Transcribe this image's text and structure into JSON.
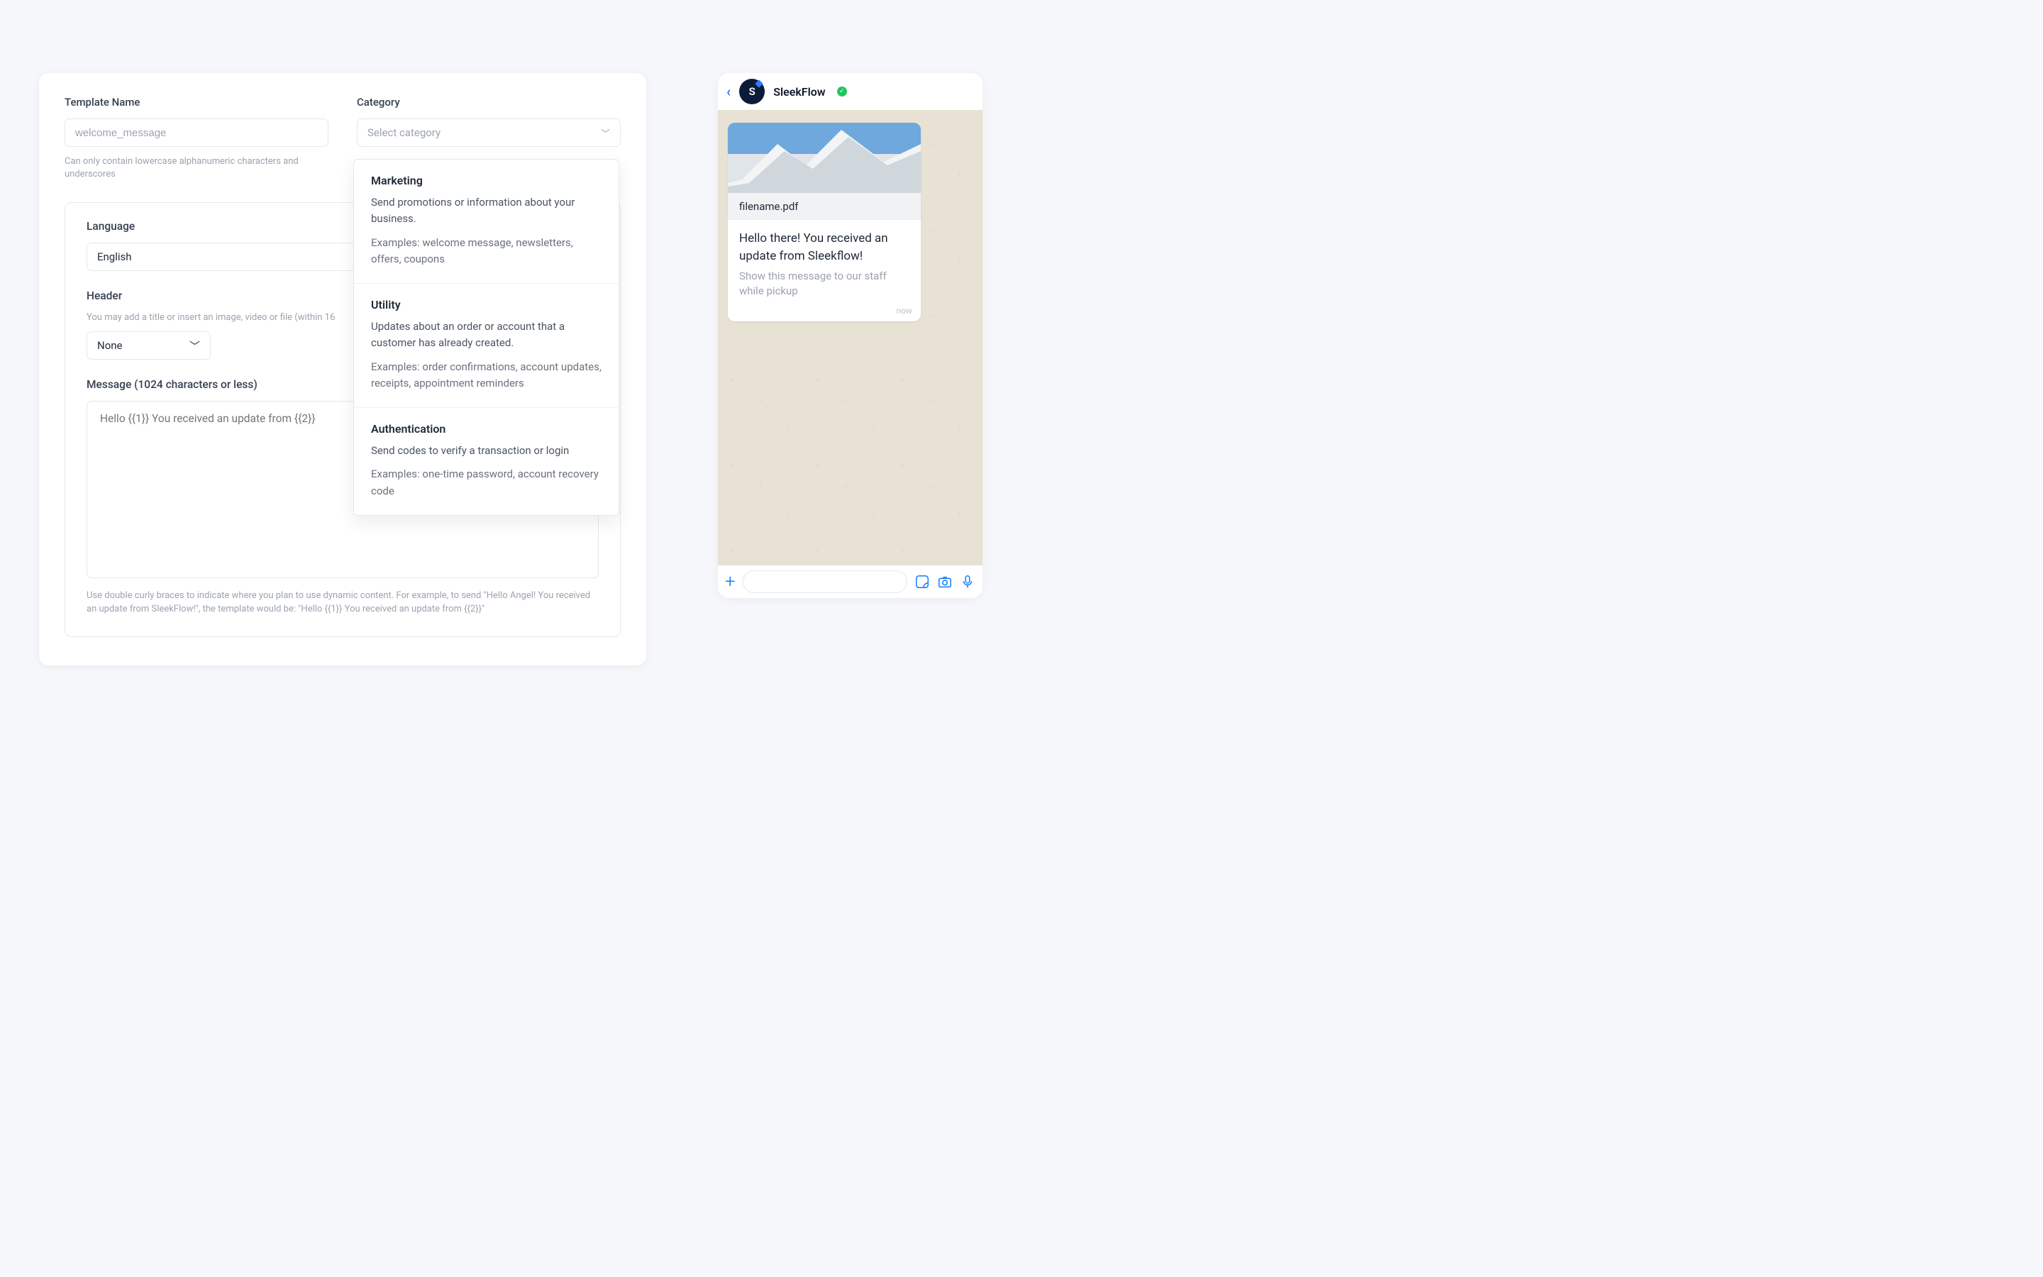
{
  "form": {
    "template_name_label": "Template Name",
    "template_name_placeholder": "welcome_message",
    "template_name_helper": "Can only contain lowercase alphanumeric characters and underscores",
    "category_label": "Category",
    "category_placeholder": "Select category",
    "lang_label": "Language",
    "lang_value": "English",
    "header_label": "Header",
    "header_desc": "You may add a title or insert an image, video or file (within 16",
    "header_value": "None",
    "message_label": "Message (1024 characters or less)",
    "message_placeholder": "Hello {{1}} You received an update from {{2}}",
    "message_hint": "Use double curly braces to indicate where you plan to use dynamic content. For example, to send \"Hello Angel! You received an update from SleekFlow!\", the template would be: \"Hello {{1}} You received an update from {{2}}\""
  },
  "categories": [
    {
      "title": "Marketing",
      "desc": "Send promotions or information about your business.",
      "ex": "Examples: welcome message, newsletters, offers, coupons"
    },
    {
      "title": "Utility",
      "desc": "Updates about an order or account that a customer has already created.",
      "ex": "Examples: order confirmations, account updates, receipts, appointment reminders"
    },
    {
      "title": "Authentication",
      "desc": "Send codes to verify a transaction or login",
      "ex": "Examples: one-time password, account recovery code"
    }
  ],
  "preview": {
    "brand": "SleekFlow",
    "avatar_letter": "S",
    "filename": "filename.pdf",
    "message": "Hello there! You received an update from Sleekflow!",
    "footer": "Show this message to our staff while pickup",
    "time": "now"
  }
}
